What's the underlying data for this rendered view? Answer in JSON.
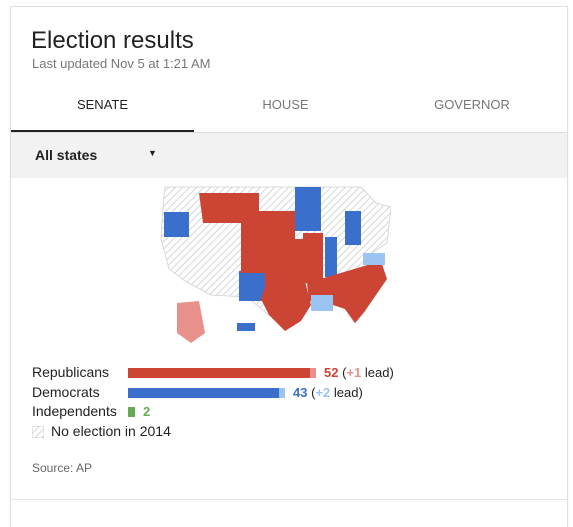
{
  "header": {
    "title": "Election results",
    "updated": "Last updated Nov 5 at 1:21 AM"
  },
  "tabs": [
    {
      "label": "SENATE",
      "active": true
    },
    {
      "label": "HOUSE",
      "active": false
    },
    {
      "label": "GOVERNOR",
      "active": false
    }
  ],
  "filter": {
    "selected": "All states"
  },
  "map_icon": "us-senate-map",
  "legend": {
    "republicans": {
      "label": "Republicans",
      "seats": "52",
      "change": "+1",
      "suffix": "lead",
      "color": "#cc4433",
      "lead_color": "#e8908a",
      "share": 0.52
    },
    "democrats": {
      "label": "Democrats",
      "seats": "43",
      "change": "+2",
      "suffix": "lead",
      "color": "#3a6fcc",
      "lead_color": "#9cc4f2",
      "share": 0.43
    },
    "independents": {
      "label": "Independents",
      "seats": "2",
      "color": "#66aa55",
      "share": 0.02
    },
    "no_election": {
      "label": "No election in 2014"
    }
  },
  "footer": {
    "source": "Source: AP"
  }
}
